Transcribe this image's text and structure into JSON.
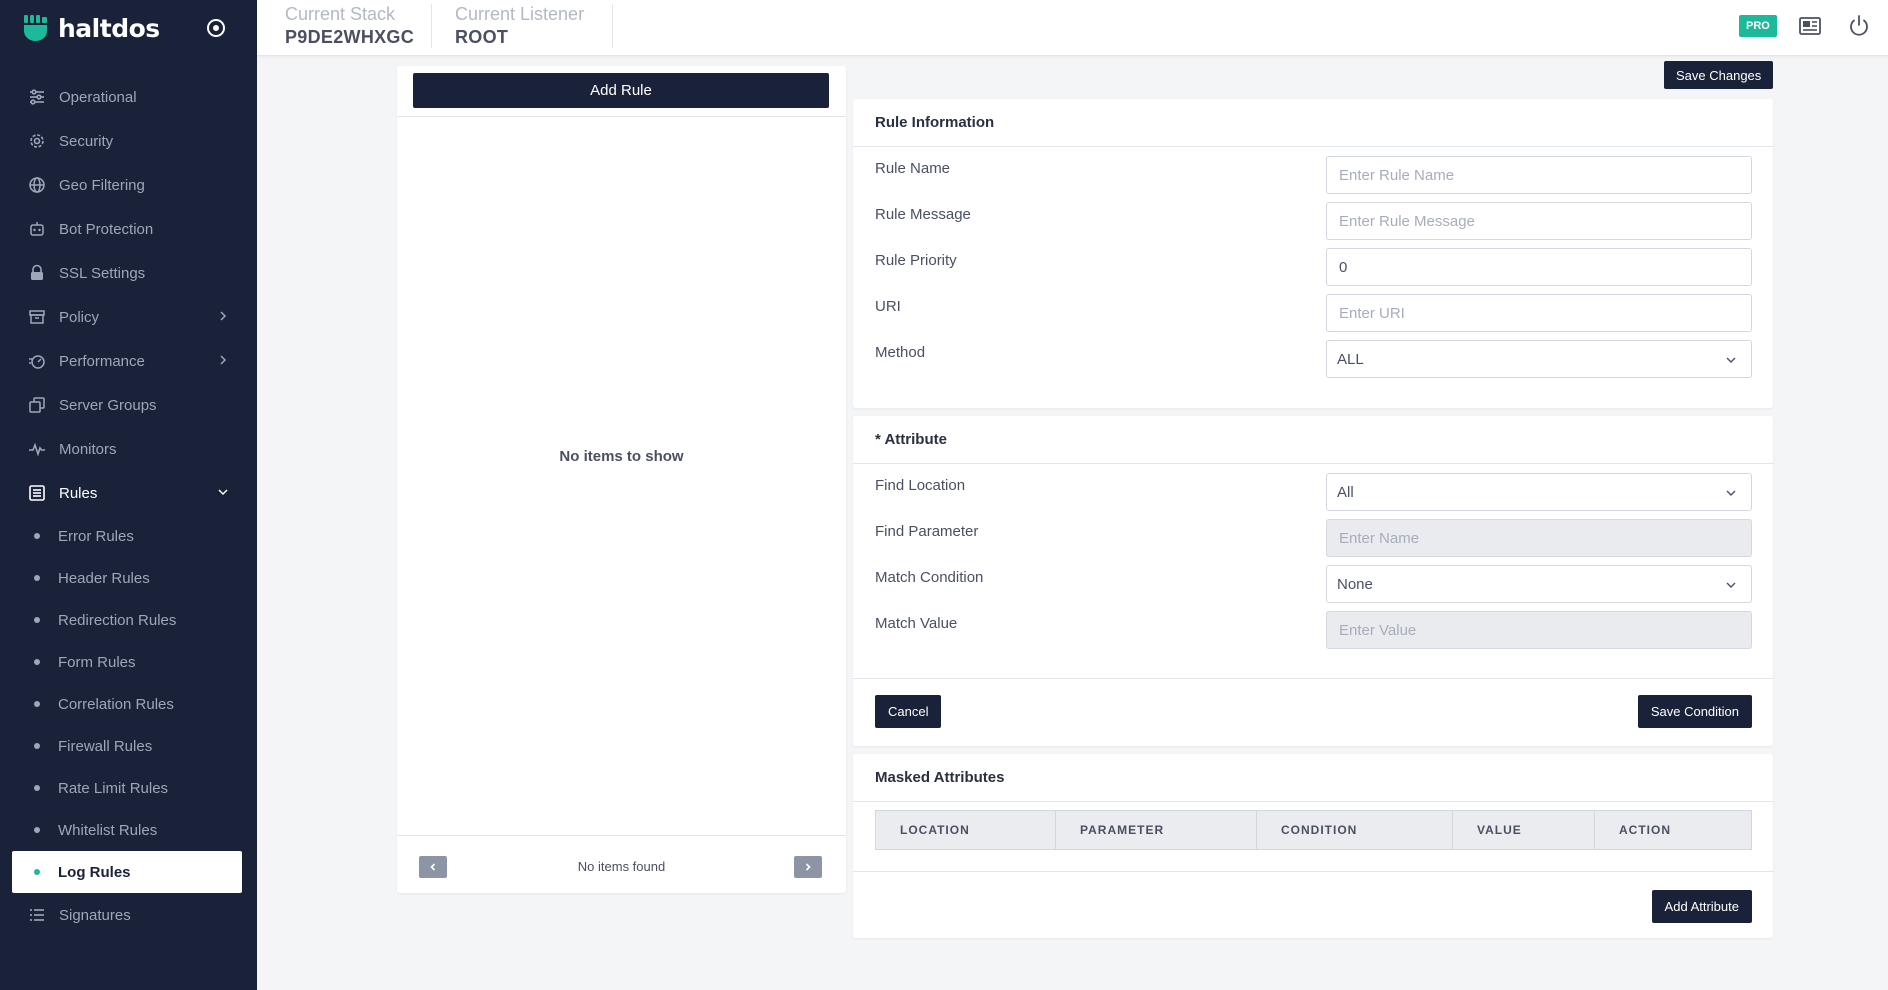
{
  "brand": {
    "name": "haltdos"
  },
  "sidebar": {
    "items": [
      {
        "label": "Operational",
        "icon": "sliders-icon"
      },
      {
        "label": "Security",
        "icon": "gear-icon"
      },
      {
        "label": "Geo Filtering",
        "icon": "globe-icon"
      },
      {
        "label": "Bot Protection",
        "icon": "robot-icon"
      },
      {
        "label": "SSL Settings",
        "icon": "lock-icon"
      },
      {
        "label": "Policy",
        "icon": "archive-icon",
        "expandable": true
      },
      {
        "label": "Performance",
        "icon": "speedometer-icon",
        "expandable": true
      },
      {
        "label": "Server Groups",
        "icon": "copy-icon"
      },
      {
        "label": "Monitors",
        "icon": "pulse-icon"
      },
      {
        "label": "Rules",
        "icon": "list-box-icon",
        "expanded": true
      }
    ],
    "rules_sub": [
      {
        "label": "Error Rules"
      },
      {
        "label": "Header Rules"
      },
      {
        "label": "Redirection Rules"
      },
      {
        "label": "Form Rules"
      },
      {
        "label": "Correlation Rules"
      },
      {
        "label": "Firewall Rules"
      },
      {
        "label": "Rate Limit Rules"
      },
      {
        "label": "Whitelist Rules"
      },
      {
        "label": "Log Rules",
        "active": true
      }
    ],
    "last_item": {
      "label": "Signatures",
      "icon": "list-icon"
    }
  },
  "header": {
    "stack_label": "Current Stack",
    "stack_value": "P9DE2WHXGC",
    "listener_label": "Current Listener",
    "listener_value": "ROOT",
    "badge": "PRO"
  },
  "left_panel": {
    "add_button": "Add Rule",
    "empty_message": "No items to show",
    "pager_text": "No items found"
  },
  "toolbar": {
    "save_changes": "Save Changes"
  },
  "rule_info": {
    "title": "Rule Information",
    "name_label": "Rule Name",
    "name_placeholder": "Enter Rule Name",
    "message_label": "Rule Message",
    "message_placeholder": "Enter Rule Message",
    "priority_label": "Rule Priority",
    "priority_value": "0",
    "uri_label": "URI",
    "uri_placeholder": "Enter URI",
    "method_label": "Method",
    "method_value": "ALL"
  },
  "attribute": {
    "title": "* Attribute",
    "location_label": "Find Location",
    "location_value": "All",
    "parameter_label": "Find Parameter",
    "parameter_placeholder": "Enter Name",
    "condition_label": "Match Condition",
    "condition_value": "None",
    "value_label": "Match Value",
    "value_placeholder": "Enter Value",
    "cancel": "Cancel",
    "save_condition": "Save Condition"
  },
  "masked": {
    "title": "Masked Attributes",
    "columns": [
      "LOCATION",
      "PARAMETER",
      "CONDITION",
      "VALUE",
      "ACTION"
    ],
    "add_button": "Add Attribute"
  },
  "colors": {
    "sidebar_bg": "#1a2239",
    "accent": "#1cb99a",
    "button_dark": "#1a2239"
  }
}
